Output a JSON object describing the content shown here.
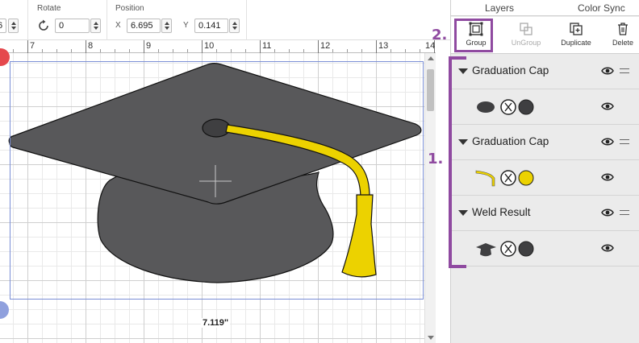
{
  "toolbar": {
    "width_value": "6",
    "rotate_label": "Rotate",
    "rotate_value": "0",
    "position_label": "Position",
    "x_axis": "X",
    "x_value": "6.695",
    "y_axis": "Y",
    "y_value": "0.141",
    "rotate_icon": "rotate-icon"
  },
  "ruler": {
    "labels": [
      "7",
      "8",
      "9",
      "10",
      "11",
      "12",
      "13",
      "14"
    ]
  },
  "canvas": {
    "dimension_label": "7.119\"",
    "colors": {
      "cap": "#58585a",
      "tassel": "#ecd200",
      "selection": "#7b8fd6"
    }
  },
  "panel": {
    "tabs": [
      "Layers",
      "Color Sync"
    ],
    "buttons": {
      "group": "Group",
      "ungroup": "UnGroup",
      "duplicate": "Duplicate",
      "delete": "Delete"
    },
    "layers": [
      {
        "title": "Graduation Cap"
      },
      {
        "title": "Graduation Cap"
      },
      {
        "title": "Weld Result"
      }
    ]
  },
  "annotations": {
    "one": "1.",
    "two": "2.",
    "color": "#8f4aa0"
  }
}
